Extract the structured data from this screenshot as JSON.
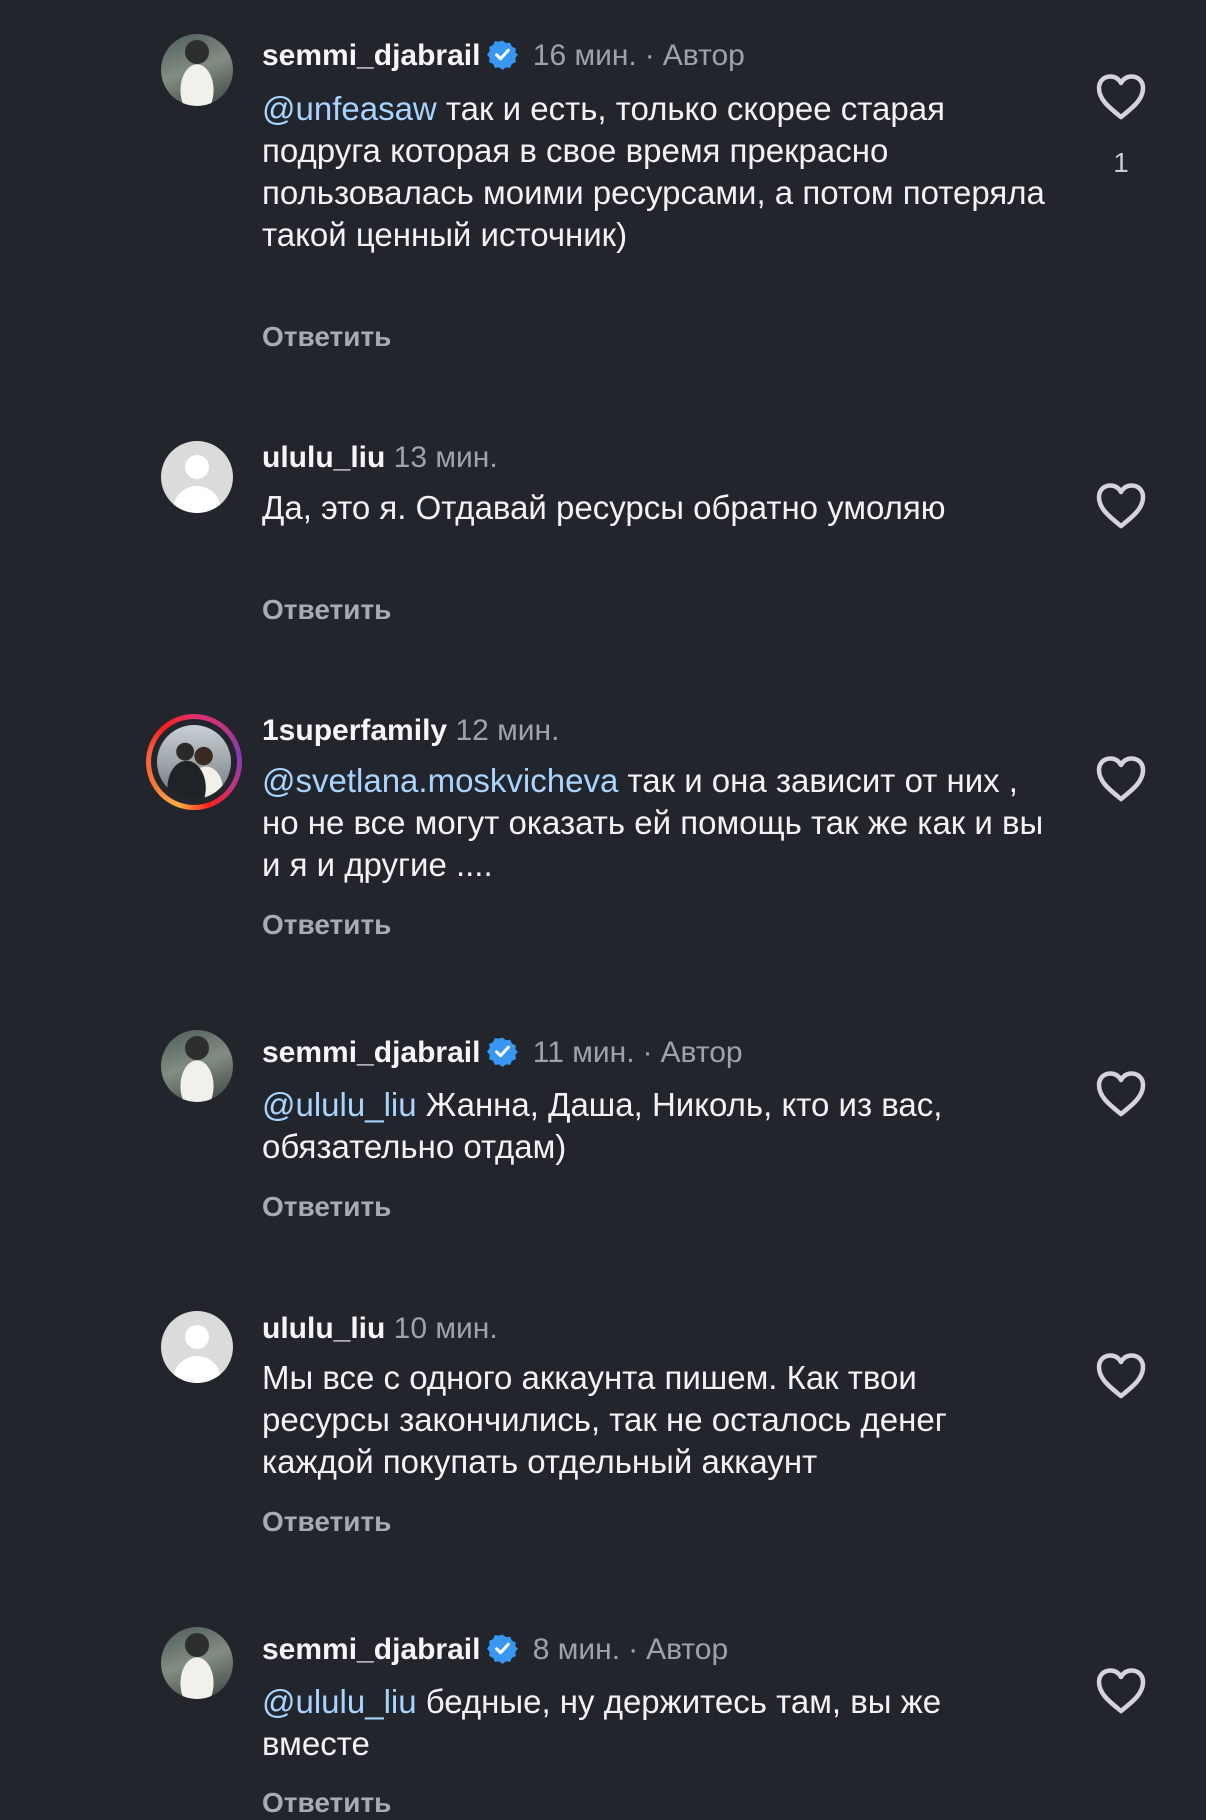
{
  "comments": [
    {
      "username": "semmi_djabrail",
      "verified": true,
      "time": "16 мин.",
      "author_label": "Автор",
      "mention": "@unfeasaw",
      "text": " так и есть, только скорее старая подруга которая в свое время прекрасно пользовалась моими ресурсами, а потом потеряла такой ценный источник)",
      "reply_label": "Ответить",
      "likes": "1",
      "avatar": "profile-photo"
    },
    {
      "username": "ululu_liu",
      "verified": false,
      "time": "13 мин.",
      "text": "Да, это я. Отдавай ресурсы обратно умоляю",
      "reply_label": "Ответить",
      "avatar": "default-avatar"
    },
    {
      "username": "1superfamily",
      "verified": false,
      "time": "12 мин.",
      "mention": "@svetlana.moskvicheva",
      "text": " так и она зависит от них , но не все могут оказать ей помощь так же как и вы и я и другие ....",
      "reply_label": "Ответить",
      "avatar": "story-ring-photo"
    },
    {
      "username": "semmi_djabrail",
      "verified": true,
      "time": "11 мин.",
      "author_label": "Автор",
      "mention": "@ululu_liu",
      "text": " Жанна, Даша, Николь, кто из вас, обязательно отдам)",
      "reply_label": "Ответить",
      "avatar": "profile-photo"
    },
    {
      "username": "ululu_liu",
      "verified": false,
      "time": "10 мин.",
      "text": "Мы все с одного аккаунта пишем. Как твои ресурсы закончились, так не осталось денег каждой покупать отдельный аккаунт",
      "reply_label": "Ответить",
      "avatar": "default-avatar"
    },
    {
      "username": "semmi_djabrail",
      "verified": true,
      "time": "8 мин.",
      "author_label": "Автор",
      "mention": "@ululu_liu",
      "text": " бедные, ну держитесь там, вы же вместе",
      "reply_label": "Ответить",
      "avatar": "profile-photo"
    }
  ],
  "separator": "·",
  "icons": {
    "like": "heart-outline-icon",
    "verified": "verified-badge-icon"
  },
  "colors": {
    "background": "#23252d",
    "mention": "#a8d4ff",
    "verified": "#3897f0",
    "secondary_text": "#9ea2ab"
  }
}
